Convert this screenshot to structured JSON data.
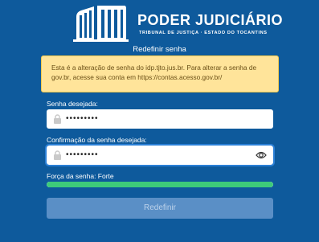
{
  "header": {
    "logo_icon": "courthouse-columns-icon",
    "title": "PODER JUDICIÁRIO",
    "subtitle": "TRIBUNAL DE JUSTIÇA · ESTADO DO TOCANTINS"
  },
  "page_title": "Redefinir senha",
  "notice": {
    "text": "Esta é a alteração de senha do idp.tjto.jus.br. Para alterar a senha de gov.br, acesse sua conta em https://contas.acesso.gov.br/"
  },
  "form": {
    "password": {
      "label": "Senha desejada:",
      "value": "•••••••••",
      "icon": "lock-icon"
    },
    "confirm": {
      "label": "Confirmação da senha desejada:",
      "value": "•••••••••",
      "icon": "lock-icon",
      "toggle_icon": "eye-icon"
    },
    "strength": {
      "label": "Força da senha: Forte",
      "level": 1.0,
      "color": "#3dcb7a"
    },
    "submit_label": "Redefinir"
  },
  "colors": {
    "background": "#0e5a9c",
    "notice_bg": "#ffe49a",
    "button_bg": "#5a8fc6"
  }
}
